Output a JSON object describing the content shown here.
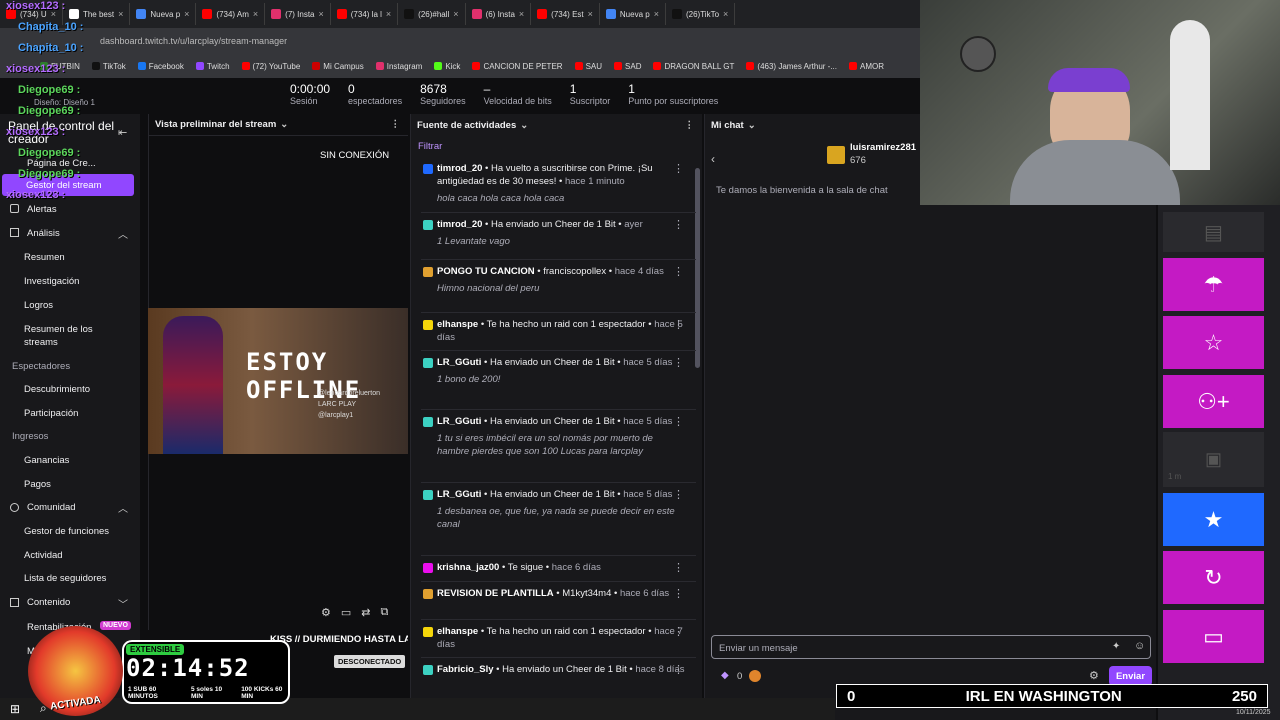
{
  "tabs": [
    "(734) U",
    "The best",
    "Nueva p",
    "(734) Am",
    "(7) Insta",
    "(734) la l",
    "(26)#hall",
    "(6) Insta",
    "(734) Est",
    "Nueva p",
    "(26)TikTo"
  ],
  "url": "dashboard.twitch.tv/u/larcplay/stream-manager",
  "bookmarks": [
    "FUTBIN",
    "TikTok",
    "Facebook",
    "Twitch",
    "(72) YouTube",
    "Mi Campus",
    "Instagram",
    "Kick",
    "CANCION DE PETER",
    "SAU",
    "SAD",
    "DRAGON BALL GT",
    "(463) James Arthur -...",
    "AMOR"
  ],
  "stats": [
    {
      "value": "0:00:00",
      "label": "Sesión"
    },
    {
      "value": "0",
      "label": "espectadores"
    },
    {
      "value": "8678",
      "label": "Seguidores"
    },
    {
      "value": "–",
      "label": "Velocidad de bits"
    },
    {
      "value": "1",
      "label": "Suscriptor"
    },
    {
      "value": "1",
      "label": "Punto por suscriptores"
    }
  ],
  "chat_overlay": [
    "xiosex123 :",
    "Chapita_10 :",
    "Chapita_10 :",
    "xiosex123 :",
    "Diegope69 :",
    "Diegope69 :",
    "xiosex123 :",
    "Diegope69 :",
    "Diegope69 :",
    "xiosex123 :"
  ],
  "sidebar": {
    "design": "Diseño: Diseño 1",
    "panel_title": "Panel de control del creador",
    "home": "Página de Cre...",
    "active": "Gestor del stream",
    "alerts": "Alertas",
    "analisis": "Análisis",
    "analisis_items": [
      "Resumen",
      "Investigación",
      "Logros",
      "Resumen de los streams"
    ],
    "espectadores": "Espectadores",
    "espectadores_items": [
      "Descubrimiento",
      "Participación"
    ],
    "ingresos": "Ingresos",
    "ingresos_items": [
      "Ganancias",
      "Pagos"
    ],
    "comunidad": "Comunidad",
    "comunidad_items": [
      "Gestor de funciones",
      "Actividad",
      "Lista de seguidores"
    ],
    "contenido": "Contenido",
    "rentabilizacion": "Rentabilización",
    "nuevo": "NUEVO",
    "mod": "Mod"
  },
  "preview": {
    "title": "Vista preliminar del stream",
    "offline": "SIN CONEXIÓN",
    "banner": "ESTOY OFFLINE",
    "handles": [
      "@leonardoreluerton",
      "LARC PLAY",
      "@larcplay1"
    ],
    "stream_title": "KISS // DURMIENDO HASTA LA",
    "status": "DESCONECTADO"
  },
  "activity": {
    "title": "Fuente de actividades",
    "filter": "Filtrar",
    "items": [
      {
        "user": "timrod_20",
        "text": "Ha vuelto a suscribirse con Prime. ¡Su antigüedad es de 30 meses!",
        "time": "hace 1 minuto",
        "msg": "hola caca hola caca hola caca"
      },
      {
        "user": "timrod_20",
        "text": "Ha enviado un Cheer de 1 Bit",
        "time": "ayer",
        "msg": "1 Levantate vago"
      },
      {
        "user": "PONGO TU CANCION",
        "text": "franciscopollex",
        "time": "hace 4 días",
        "msg": "Himno nacional del peru"
      },
      {
        "user": "elhanspe",
        "text": "Te ha hecho un raid con 1 espectador",
        "time": "hace 5 días",
        "msg": ""
      },
      {
        "user": "LR_GGuti",
        "text": "Ha enviado un Cheer de 1 Bit",
        "time": "hace 5 días",
        "msg": "1 bono de 200!"
      },
      {
        "user": "LR_GGuti",
        "text": "Ha enviado un Cheer de 1 Bit",
        "time": "hace 5 días",
        "msg": "1 tu si eres imbécil era un sol nomás por muerto de hambre pierdes que son 100 Lucas para larcplay"
      },
      {
        "user": "LR_GGuti",
        "text": "Ha enviado un Cheer de 1 Bit",
        "time": "hace 5 días",
        "msg": "1 desbanea oe, que fue, ya nada se puede decir en este canal"
      },
      {
        "user": "krishna_jaz00",
        "text": "Te sigue",
        "time": "hace 6 días",
        "msg": ""
      },
      {
        "user": "REVISION DE PLANTILLA",
        "text": "M1kyt34m4",
        "time": "hace 6 días",
        "msg": ""
      },
      {
        "user": "elhanspe",
        "text": "Te ha hecho un raid con 1 espectador",
        "time": "hace 7 días",
        "msg": ""
      },
      {
        "user": "Fabricio_Sly",
        "text": "Ha enviado un Cheer de 1 Bit",
        "time": "hace 8 días",
        "msg": ""
      }
    ]
  },
  "chat": {
    "title": "Mi chat",
    "gifter": "luisramirez281",
    "gifter_count": "676",
    "welcome": "Te damos la bienvenida a la sala de chat",
    "placeholder": "Enviar un mensaje",
    "points": "0",
    "send": "Enviar"
  },
  "right_panel": {
    "timer_label": "1 m"
  },
  "timer": {
    "tag": "EXTENSIBLE",
    "time": "02:14:52",
    "stats": [
      "1 SUB 60 MINUTOS",
      "5 soles 10 MIN",
      "100 KICKs 60 MIN"
    ],
    "mode": "ACTIVADA"
  },
  "irl": {
    "left": "0",
    "title": "IRL EN WASHINGTON",
    "right": "250"
  },
  "clock": {
    "date": "10/11/2025"
  }
}
